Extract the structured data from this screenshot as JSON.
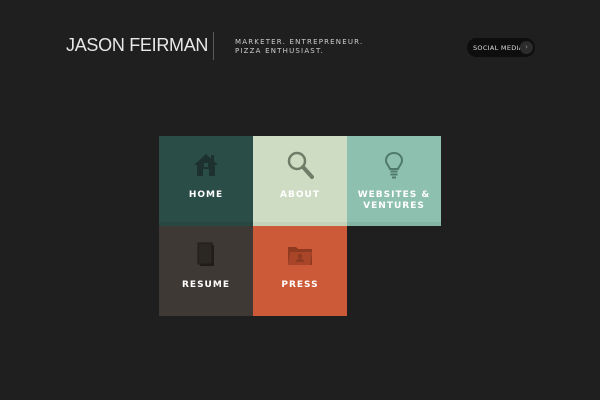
{
  "header": {
    "name": "JASON FEIRMAN",
    "tagline_line1": "MARKETER. ENTREPRENEUR.",
    "tagline_line2": "PIZZA ENTHUSIAST.",
    "social_label": "SOCIAL MEDIA",
    "social_arrow_icon": "chevron-right-icon"
  },
  "tiles": [
    {
      "label": "HOME",
      "icon": "house-icon",
      "color": "#2b4d47"
    },
    {
      "label": "ABOUT",
      "icon": "magnifier-icon",
      "color": "#cfdcc4"
    },
    {
      "label_line1": "WEBSITES &",
      "label_line2": "VENTURES",
      "icon": "lightbulb-icon",
      "color": "#8dc0af"
    },
    {
      "label": "RESUME",
      "icon": "document-icon",
      "color": "#3e3934"
    },
    {
      "label": "PRESS",
      "icon": "folder-icon",
      "color": "#cc5a38"
    }
  ],
  "colors": {
    "background": "#1f1f1f",
    "text": "#e8e8e8"
  }
}
